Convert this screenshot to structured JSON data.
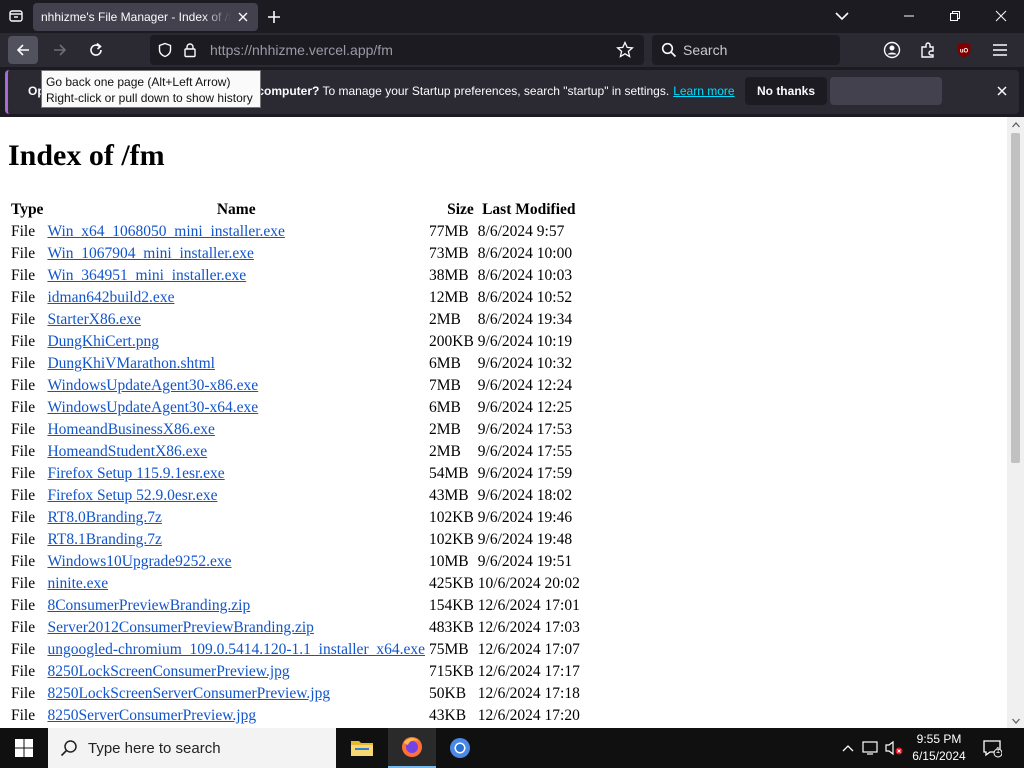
{
  "browser": {
    "tab_title": "nhhizme's File Manager - Index of /fm",
    "url_host": "https://nhhizme.vercel.app",
    "url_path": "/fm",
    "search_placeholder": "Search"
  },
  "notification": {
    "prefix": "Ope",
    "bold": "computer?",
    "message": "To manage your Startup preferences, search \"startup\" in settings.",
    "link": "Learn more",
    "no_thanks": "No thanks"
  },
  "tooltip": {
    "line1": "Go back one page (Alt+Left Arrow)",
    "line2": "Right-click or pull down to show history"
  },
  "page": {
    "title": "Index of /fm",
    "columns": [
      "Type",
      "Name",
      "Size",
      "Last Modified"
    ],
    "rows": [
      {
        "type": "File",
        "name": "Win_x64_1068050_mini_installer.exe",
        "size": "77MB",
        "modified": "8/6/2024 9:57"
      },
      {
        "type": "File",
        "name": "Win_1067904_mini_installer.exe",
        "size": "73MB",
        "modified": "8/6/2024 10:00"
      },
      {
        "type": "File",
        "name": "Win_364951_mini_installer.exe",
        "size": "38MB",
        "modified": "8/6/2024 10:03"
      },
      {
        "type": "File",
        "name": "idman642build2.exe",
        "size": "12MB",
        "modified": "8/6/2024 10:52"
      },
      {
        "type": "File",
        "name": "StarterX86.exe",
        "size": "2MB",
        "modified": "8/6/2024 19:34"
      },
      {
        "type": "File",
        "name": "DungKhiCert.png",
        "size": "200KB",
        "modified": "9/6/2024 10:19"
      },
      {
        "type": "File",
        "name": "DungKhiVMarathon.shtml",
        "size": "6MB",
        "modified": "9/6/2024 10:32"
      },
      {
        "type": "File",
        "name": "WindowsUpdateAgent30-x86.exe",
        "size": "7MB",
        "modified": "9/6/2024 12:24"
      },
      {
        "type": "File",
        "name": "WindowsUpdateAgent30-x64.exe",
        "size": "6MB",
        "modified": "9/6/2024 12:25"
      },
      {
        "type": "File",
        "name": "HomeandBusinessX86.exe",
        "size": "2MB",
        "modified": "9/6/2024 17:53"
      },
      {
        "type": "File",
        "name": "HomeandStudentX86.exe",
        "size": "2MB",
        "modified": "9/6/2024 17:55"
      },
      {
        "type": "File",
        "name": "Firefox Setup 115.9.1esr.exe",
        "size": "54MB",
        "modified": "9/6/2024 17:59"
      },
      {
        "type": "File",
        "name": "Firefox Setup 52.9.0esr.exe",
        "size": "43MB",
        "modified": "9/6/2024 18:02"
      },
      {
        "type": "File",
        "name": "RT8.0Branding.7z",
        "size": "102KB",
        "modified": "9/6/2024 19:46"
      },
      {
        "type": "File",
        "name": "RT8.1Branding.7z",
        "size": "102KB",
        "modified": "9/6/2024 19:48"
      },
      {
        "type": "File",
        "name": "Windows10Upgrade9252.exe",
        "size": "10MB",
        "modified": "9/6/2024 19:51"
      },
      {
        "type": "File",
        "name": "ninite.exe",
        "size": "425KB",
        "modified": "10/6/2024 20:02"
      },
      {
        "type": "File",
        "name": "8ConsumerPreviewBranding.zip",
        "size": "154KB",
        "modified": "12/6/2024 17:01"
      },
      {
        "type": "File",
        "name": "Server2012ConsumerPreviewBranding.zip",
        "size": "483KB",
        "modified": "12/6/2024 17:03"
      },
      {
        "type": "File",
        "name": "ungoogled-chromium_109.0.5414.120-1.1_installer_x64.exe",
        "size": "75MB",
        "modified": "12/6/2024 17:07"
      },
      {
        "type": "File",
        "name": "8250LockScreenConsumerPreview.jpg",
        "size": "715KB",
        "modified": "12/6/2024 17:17"
      },
      {
        "type": "File",
        "name": "8250LockScreenServerConsumerPreview.jpg",
        "size": "50KB",
        "modified": "12/6/2024 17:18"
      },
      {
        "type": "File",
        "name": "8250ServerConsumerPreview.jpg",
        "size": "43KB",
        "modified": "12/6/2024 17:20"
      }
    ]
  },
  "taskbar": {
    "search_placeholder": "Type here to search",
    "time": "9:55 PM",
    "date": "6/15/2024",
    "notification_count": "1"
  },
  "colors": {
    "link": "#1155cc",
    "accent_link": "#00ddff",
    "notification_stripe": "#a86bd6"
  }
}
